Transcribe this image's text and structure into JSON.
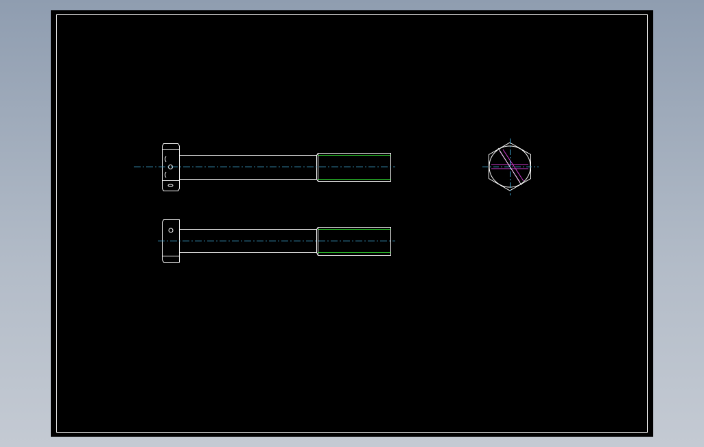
{
  "drawing": {
    "background": "#000000",
    "colors": {
      "outline": "#ffffff",
      "centerline": "#3fa9d6",
      "thread": "#2fd42f",
      "hatch": "#d23cd2"
    },
    "views": [
      {
        "name": "front-view",
        "description_visible": false
      },
      {
        "name": "top-view",
        "description_visible": false
      },
      {
        "name": "end-view-hexagon",
        "description_visible": false
      }
    ]
  }
}
